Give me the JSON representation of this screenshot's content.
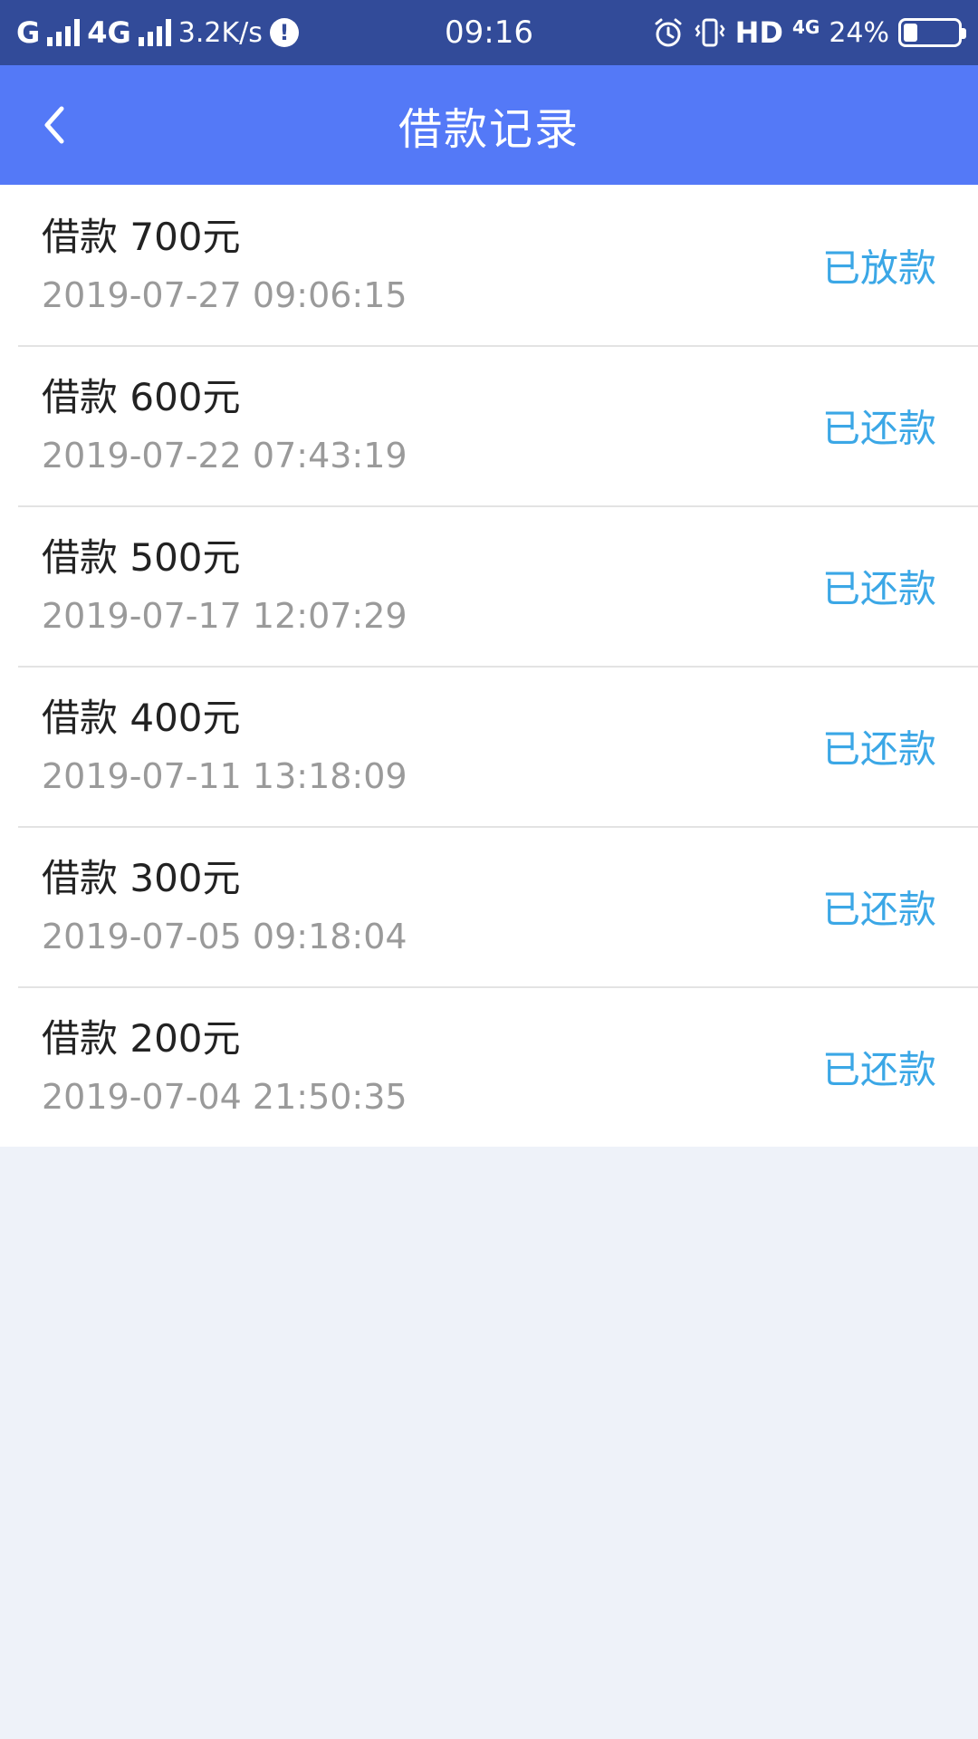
{
  "status_bar": {
    "carrier1": "G",
    "carrier2": "4G",
    "speed": "3.2K/s",
    "alert": "!",
    "time": "09:16",
    "hd": "HD",
    "network_small": "4G",
    "battery_text": "24%",
    "battery_level": 0.24
  },
  "header": {
    "back_icon": "chevron-left-icon",
    "title": "借款记录"
  },
  "records": [
    {
      "title": "借款 700元",
      "time": "2019-07-27 09:06:15",
      "status": "已放款"
    },
    {
      "title": "借款 600元",
      "time": "2019-07-22 07:43:19",
      "status": "已还款"
    },
    {
      "title": "借款 500元",
      "time": "2019-07-17 12:07:29",
      "status": "已还款"
    },
    {
      "title": "借款 400元",
      "time": "2019-07-11 13:18:09",
      "status": "已还款"
    },
    {
      "title": "借款 300元",
      "time": "2019-07-05 09:18:04",
      "status": "已还款"
    },
    {
      "title": "借款 200元",
      "time": "2019-07-04 21:50:35",
      "status": "已还款"
    }
  ],
  "colors": {
    "status_bar": "#324B99",
    "header": "#5479F7",
    "status_text": "#3BA7E6",
    "page_bg": "#EEF2F9"
  }
}
